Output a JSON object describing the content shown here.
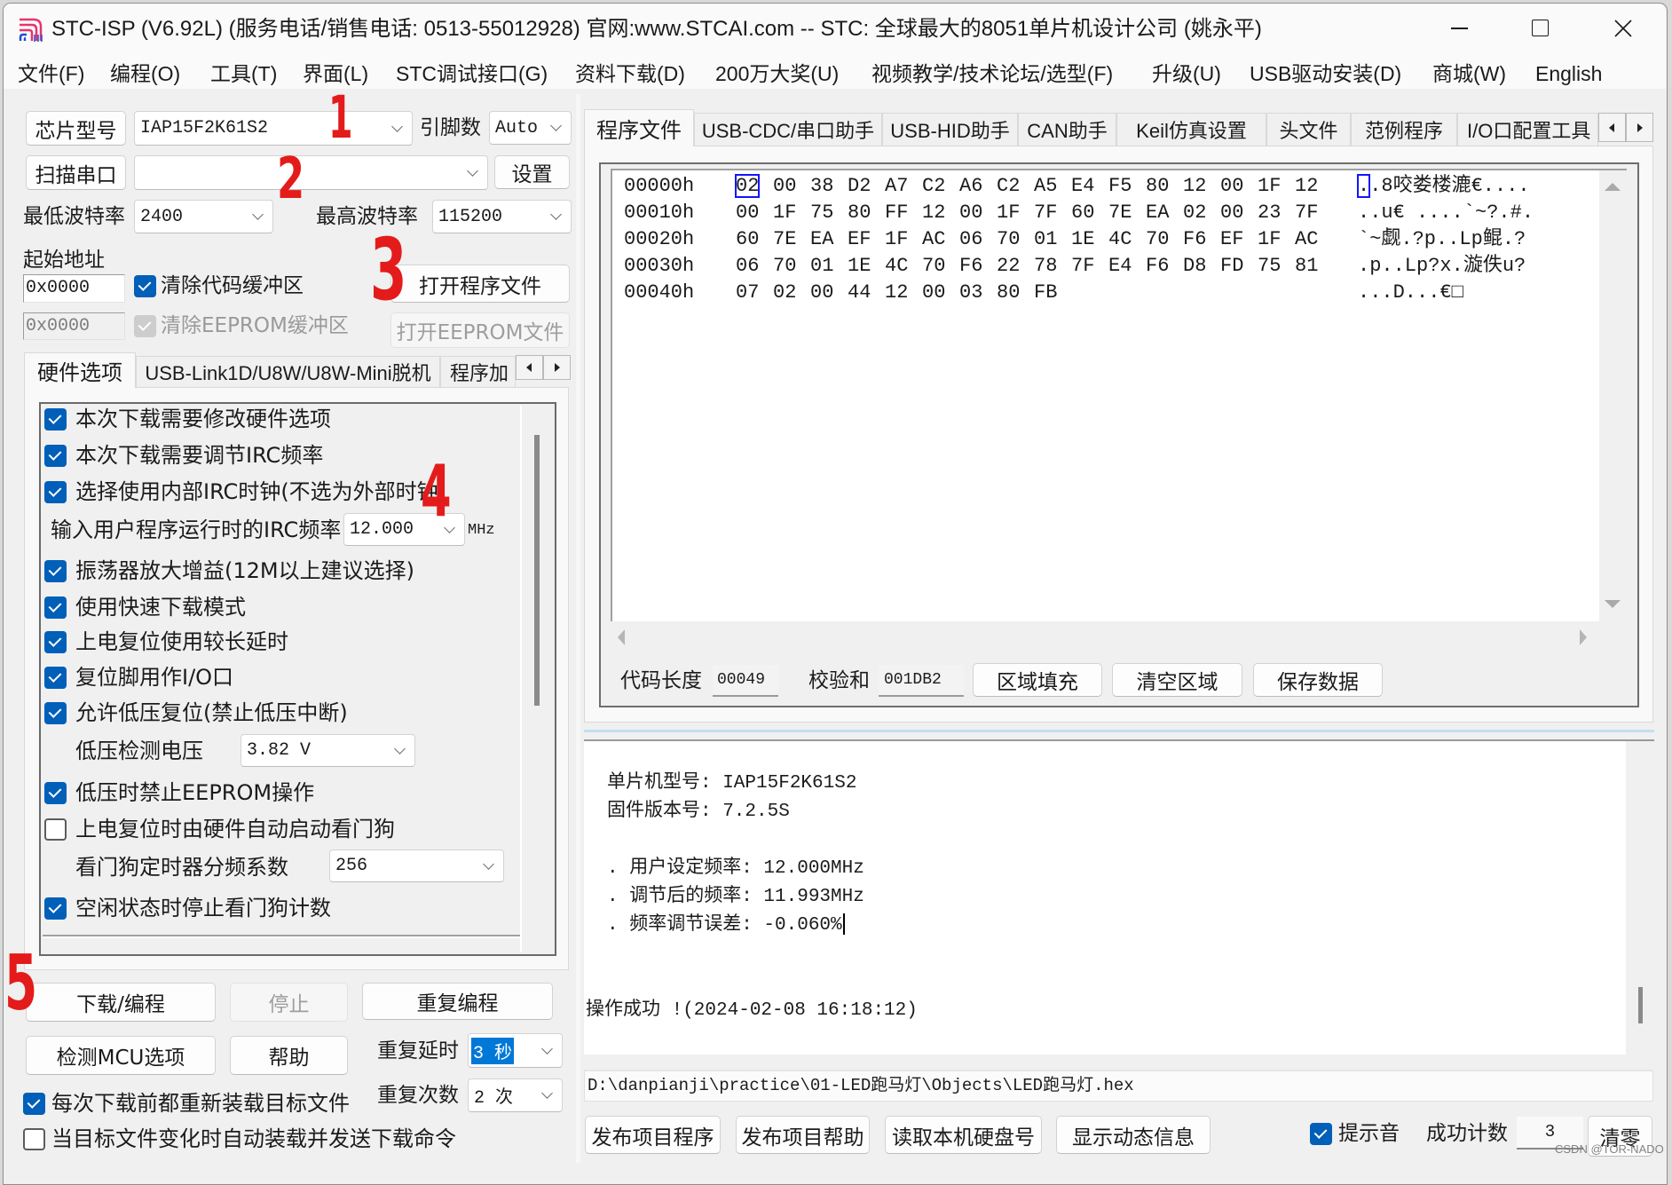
{
  "colors": {
    "accent": "#005fb8",
    "annotation": "#e41b1b",
    "selection": "#0078d7",
    "hex_cursor": "#1414ff"
  },
  "window": {
    "title": "STC-ISP (V6.92L) (服务电话/销售电话: 0513-55012928) 官网:www.STCAI.com  -- STC: 全球最大的8051单片机设计公司 (姚永平)"
  },
  "menu": [
    "文件(F)",
    "编程(O)",
    "工具(T)",
    "界面(L)",
    "STC调试接口(G)",
    "资料下载(D)",
    "200万大奖(U)",
    "视频教学/技术论坛/选型(F)",
    "升级(U)",
    "USB驱动安装(D)",
    "商城(W)",
    "English"
  ],
  "chip": {
    "button": "芯片型号",
    "value": "IAP15F2K61S2",
    "pins_label": "引脚数",
    "pins_value": "Auto"
  },
  "port": {
    "button": "扫描串口",
    "value": "",
    "settings": "设置"
  },
  "baud": {
    "min_label": "最低波特率",
    "min_value": "2400",
    "max_label": "最高波特率",
    "max_value": "115200"
  },
  "address": {
    "label": "起始地址",
    "code_addr": "0x0000",
    "eeprom_addr": "0x0000",
    "clear_code": {
      "label": "清除代码缓冲区",
      "checked": true
    },
    "clear_eeprom": {
      "label": "清除EEPROM缓冲区",
      "checked": true,
      "disabled": true
    },
    "open_program": "打开程序文件",
    "open_eeprom": "打开EEPROM文件"
  },
  "left_tabs": {
    "items": [
      "硬件选项",
      "USB-Link1D/U8W/U8W-Mini脱机",
      "程序加"
    ],
    "active": 0
  },
  "hardware": {
    "items": [
      {
        "label": "本次下载需要修改硬件选项",
        "checked": true
      },
      {
        "label": "本次下载需要调节IRC频率",
        "checked": true
      },
      {
        "label": "选择使用内部IRC时钟(不选为外部时钟)",
        "checked": true
      },
      {
        "label": "振荡器放大增益(12M以上建议选择)",
        "checked": true
      },
      {
        "label": "使用快速下载模式",
        "checked": true
      },
      {
        "label": "上电复位使用较长延时",
        "checked": true
      },
      {
        "label": "复位脚用作I/O口",
        "checked": true
      },
      {
        "label": "允许低压复位(禁止低压中断)",
        "checked": true
      },
      {
        "label": "低压时禁止EEPROM操作",
        "checked": true
      },
      {
        "label": "上电复位时由硬件自动启动看门狗",
        "checked": false
      },
      {
        "label": "空闲状态时停止看门狗计数",
        "checked": true
      }
    ],
    "irc_freq": {
      "label": "输入用户程序运行时的IRC频率",
      "value": "12.000",
      "unit": "MHz"
    },
    "lvd_voltage": {
      "label": "低压检测电压",
      "value": "3.82 V"
    },
    "wdt_prescaler": {
      "label": "看门狗定时器分频系数",
      "value": "256"
    }
  },
  "actions": {
    "download": "下载/编程",
    "stop": "停止",
    "repeat_program": "重复编程",
    "detect_mcu": "检测MCU选项",
    "help": "帮助",
    "repeat_delay": {
      "label": "重复延时",
      "value": "3 秒"
    },
    "repeat_count": {
      "label": "重复次数",
      "value": "2 次"
    },
    "reload_before": {
      "label": "每次下载前都重新装载目标文件",
      "checked": true
    },
    "auto_reload": {
      "label": "当目标文件变化时自动装载并发送下载命令",
      "checked": false
    }
  },
  "right_tabs": {
    "items": [
      "程序文件",
      "USB-CDC/串口助手",
      "USB-HID助手",
      "CAN助手",
      "Keil仿真设置",
      "头文件",
      "范例程序",
      "I/O口配置工具"
    ],
    "active": 0
  },
  "hex": {
    "selected": {
      "row": 0,
      "byte": 0
    },
    "rows": [
      {
        "addr": "00000h",
        "bytes": [
          "02",
          "00",
          "38",
          "D2",
          "A7",
          "C2",
          "A6",
          "C2",
          "A5",
          "E4",
          "F5",
          "80",
          "12",
          "00",
          "1F",
          "12"
        ],
        "ascii": "..8咬娄楼漉€...."
      },
      {
        "addr": "00010h",
        "bytes": [
          "00",
          "1F",
          "75",
          "80",
          "FF",
          "12",
          "00",
          "1F",
          "7F",
          "60",
          "7E",
          "EA",
          "02",
          "00",
          "23",
          "7F"
        ],
        "ascii": "..u€ ....`~?.#."
      },
      {
        "addr": "00020h",
        "bytes": [
          "60",
          "7E",
          "EA",
          "EF",
          "1F",
          "AC",
          "06",
          "70",
          "01",
          "1E",
          "4C",
          "70",
          "F6",
          "EF",
          "1F",
          "AC"
        ],
        "ascii": "`~觑.?p..Lp鲲.?"
      },
      {
        "addr": "00030h",
        "bytes": [
          "06",
          "70",
          "01",
          "1E",
          "4C",
          "70",
          "F6",
          "22",
          "78",
          "7F",
          "E4",
          "F6",
          "D8",
          "FD",
          "75",
          "81"
        ],
        "ascii": ".p..Lp?x.漩佚u?"
      },
      {
        "addr": "00040h",
        "bytes": [
          "07",
          "02",
          "00",
          "44",
          "12",
          "00",
          "03",
          "80",
          "FB"
        ],
        "ascii": "...D...€□"
      }
    ]
  },
  "code_info": {
    "length_label": "代码长度",
    "length": "00049",
    "checksum_label": "校验和",
    "checksum": "001DB2",
    "fill": "区域填充",
    "clear": "清空区域",
    "save": "保存数据"
  },
  "log": {
    "lines": [
      "",
      "单片机型号: IAP15F2K61S2",
      "固件版本号: 7.2.5S",
      "",
      ". 用户设定频率: 12.000MHz",
      ". 调节后的频率: 11.993MHz",
      ". 频率调节误差: -0.060%",
      "",
      "",
      "操作成功 !(2024-02-08 16:18:12)"
    ]
  },
  "file_path": "D:\\danpianji\\practice\\01-LED跑马灯\\Objects\\LED跑马灯.hex",
  "footer": {
    "publish_program": "发布项目程序",
    "publish_help": "发布项目帮助",
    "read_disk_id": "读取本机硬盘号",
    "show_dynamic_info": "显示动态信息",
    "beep": {
      "label": "提示音",
      "checked": true
    },
    "success_count_label": "成功计数",
    "success_count": "3",
    "reset": "清零"
  },
  "annotations": [
    "1",
    "2",
    "3",
    "4",
    "5"
  ],
  "watermark": "CSDN @TOR-NADO"
}
